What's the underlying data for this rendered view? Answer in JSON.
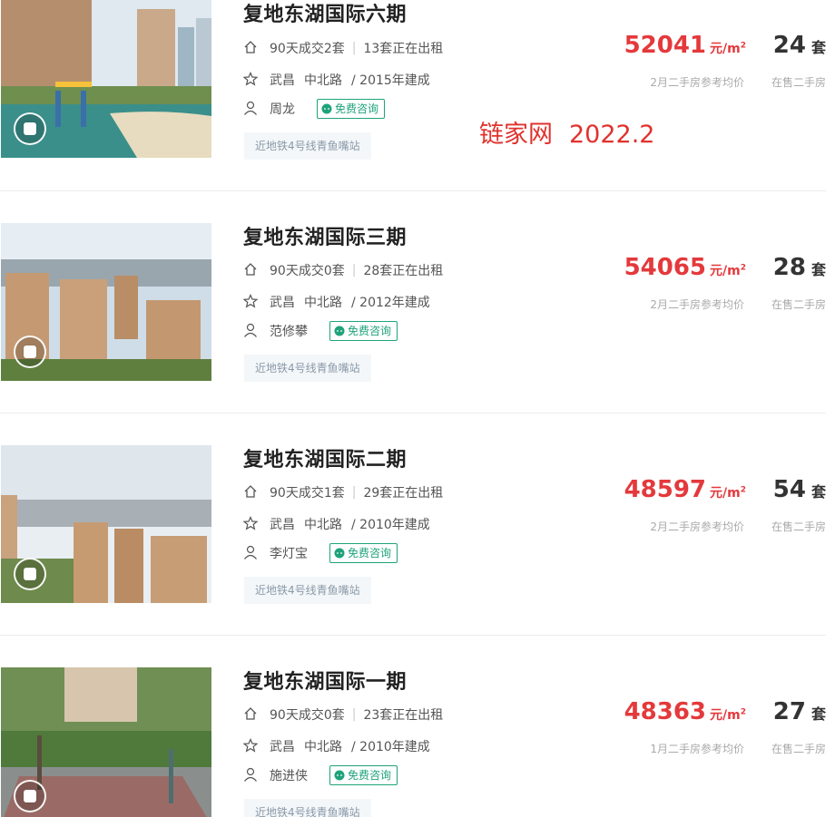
{
  "watermark": {
    "site": "链家网",
    "date": "2022.2"
  },
  "common": {
    "consult_label": "免费咨询",
    "count_unit": "套"
  },
  "listings": [
    {
      "title": "复地东湖国际六期",
      "deals": "90天成交2套",
      "renting": "13套正在出租",
      "district": "武昌",
      "area": "中北路",
      "built": "/ 2015年建成",
      "agent": "周龙",
      "tag": "近地铁4号线青鱼嘴站",
      "price": "52041",
      "price_unit": "元/m",
      "price_sup": "2",
      "price_label": "2月二手房参考均价",
      "on_sale": "24",
      "on_sale_label": "在售二手房"
    },
    {
      "title": "复地东湖国际三期",
      "deals": "90天成交0套",
      "renting": "28套正在出租",
      "district": "武昌",
      "area": "中北路",
      "built": "/ 2012年建成",
      "agent": "范修攀",
      "tag": "近地铁4号线青鱼嘴站",
      "price": "54065",
      "price_unit": "元/m",
      "price_sup": "2",
      "price_label": "2月二手房参考均价",
      "on_sale": "28",
      "on_sale_label": "在售二手房"
    },
    {
      "title": "复地东湖国际二期",
      "deals": "90天成交1套",
      "renting": "29套正在出租",
      "district": "武昌",
      "area": "中北路",
      "built": "/ 2010年建成",
      "agent": "李灯宝",
      "tag": "近地铁4号线青鱼嘴站",
      "price": "48597",
      "price_unit": "元/m",
      "price_sup": "2",
      "price_label": "2月二手房参考均价",
      "on_sale": "54",
      "on_sale_label": "在售二手房"
    },
    {
      "title": "复地东湖国际一期",
      "deals": "90天成交0套",
      "renting": "23套正在出租",
      "district": "武昌",
      "area": "中北路",
      "built": "/ 2010年建成",
      "agent": "施进侠",
      "tag": "近地铁4号线青鱼嘴站",
      "price": "48363",
      "price_unit": "元/m",
      "price_sup": "2",
      "price_label": "1月二手房参考均价",
      "on_sale": "27",
      "on_sale_label": "在售二手房"
    }
  ]
}
